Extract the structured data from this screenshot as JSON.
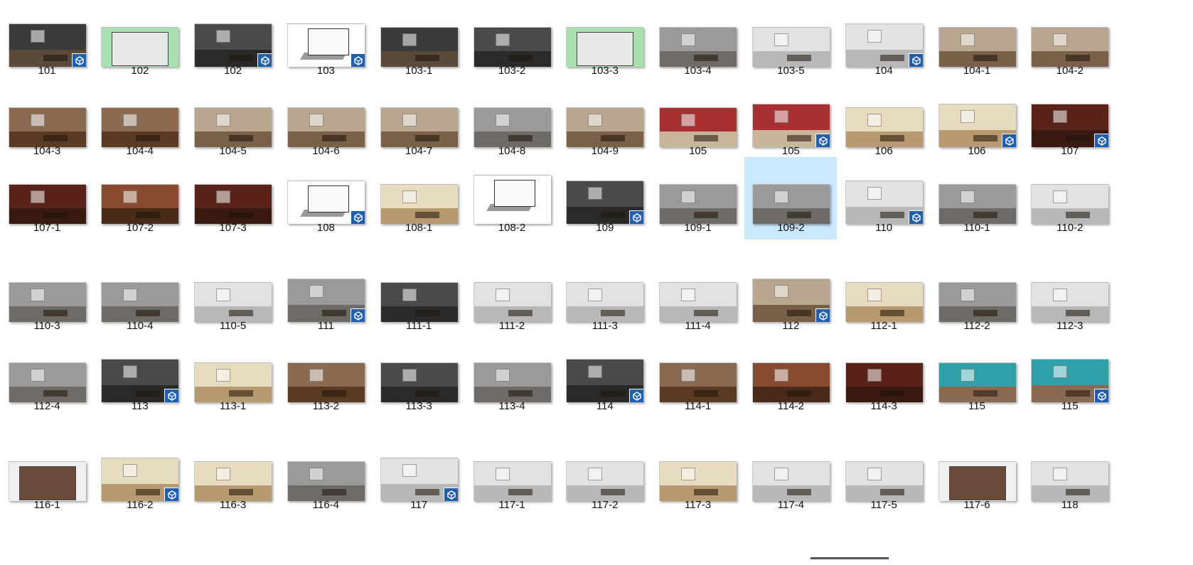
{
  "explorer": {
    "view": "large-icons",
    "selected_label": "109-2",
    "badge_icon": "sketchup-icon",
    "accent": "#cce8ff",
    "badge_color": "#1f5fae"
  },
  "rows": [
    [
      {
        "label": "101",
        "badge": true,
        "style": "dark"
      },
      {
        "label": "102",
        "badge": false,
        "style": "plan-green"
      },
      {
        "label": "102",
        "badge": true,
        "style": "gray-dark"
      },
      {
        "label": "103",
        "badge": true,
        "style": "sketch"
      },
      {
        "label": "103-1",
        "badge": false,
        "style": "dark"
      },
      {
        "label": "103-2",
        "badge": false,
        "style": "gray-dark"
      },
      {
        "label": "103-3",
        "badge": false,
        "style": "plan-green"
      },
      {
        "label": "103-4",
        "badge": false,
        "style": "gray"
      },
      {
        "label": "103-5",
        "badge": false,
        "style": "light"
      },
      {
        "label": "104",
        "badge": true,
        "style": "light"
      },
      {
        "label": "104-1",
        "badge": false,
        "style": "warm"
      },
      {
        "label": "104-2",
        "badge": false,
        "style": "warm"
      }
    ],
    [
      {
        "label": "104-3",
        "badge": false,
        "style": "wood"
      },
      {
        "label": "104-4",
        "badge": false,
        "style": "wood"
      },
      {
        "label": "104-5",
        "badge": false,
        "style": "warm"
      },
      {
        "label": "104-6",
        "badge": false,
        "style": "warm"
      },
      {
        "label": "104-7",
        "badge": false,
        "style": "warm"
      },
      {
        "label": "104-8",
        "badge": false,
        "style": "gray"
      },
      {
        "label": "104-9",
        "badge": false,
        "style": "warm"
      },
      {
        "label": "105",
        "badge": false,
        "style": "red"
      },
      {
        "label": "105",
        "badge": true,
        "style": "red"
      },
      {
        "label": "106",
        "badge": false,
        "style": "beige"
      },
      {
        "label": "106",
        "badge": true,
        "style": "beige"
      },
      {
        "label": "107",
        "badge": true,
        "style": "darkred"
      }
    ],
    [
      {
        "label": "107-1",
        "badge": false,
        "style": "darkred"
      },
      {
        "label": "107-2",
        "badge": false,
        "style": "brick"
      },
      {
        "label": "107-3",
        "badge": false,
        "style": "darkred"
      },
      {
        "label": "108",
        "badge": true,
        "style": "sketch"
      },
      {
        "label": "108-1",
        "badge": false,
        "style": "beige"
      },
      {
        "label": "108-2",
        "badge": false,
        "style": "sketch"
      },
      {
        "label": "109",
        "badge": true,
        "style": "gray-dark"
      },
      {
        "label": "109-1",
        "badge": false,
        "style": "gray"
      },
      {
        "label": "109-2",
        "badge": false,
        "style": "gray"
      },
      {
        "label": "110",
        "badge": true,
        "style": "light"
      },
      {
        "label": "110-1",
        "badge": false,
        "style": "gray"
      },
      {
        "label": "110-2",
        "badge": false,
        "style": "light"
      }
    ],
    [
      {
        "label": "110-3",
        "badge": false,
        "style": "gray"
      },
      {
        "label": "110-4",
        "badge": false,
        "style": "gray"
      },
      {
        "label": "110-5",
        "badge": false,
        "style": "light"
      },
      {
        "label": "111",
        "badge": true,
        "style": "gray"
      },
      {
        "label": "111-1",
        "badge": false,
        "style": "gray-dark"
      },
      {
        "label": "111-2",
        "badge": false,
        "style": "light"
      },
      {
        "label": "111-3",
        "badge": false,
        "style": "light"
      },
      {
        "label": "111-4",
        "badge": false,
        "style": "light"
      },
      {
        "label": "112",
        "badge": true,
        "style": "warm"
      },
      {
        "label": "112-1",
        "badge": false,
        "style": "beige"
      },
      {
        "label": "112-2",
        "badge": false,
        "style": "gray"
      },
      {
        "label": "112-3",
        "badge": false,
        "style": "light"
      }
    ],
    [
      {
        "label": "112-4",
        "badge": false,
        "style": "gray"
      },
      {
        "label": "113",
        "badge": true,
        "style": "gray-dark"
      },
      {
        "label": "113-1",
        "badge": false,
        "style": "beige"
      },
      {
        "label": "113-2",
        "badge": false,
        "style": "wood"
      },
      {
        "label": "113-3",
        "badge": false,
        "style": "gray-dark"
      },
      {
        "label": "113-4",
        "badge": false,
        "style": "gray"
      },
      {
        "label": "114",
        "badge": true,
        "style": "gray-dark"
      },
      {
        "label": "114-1",
        "badge": false,
        "style": "wood"
      },
      {
        "label": "114-2",
        "badge": false,
        "style": "brick"
      },
      {
        "label": "114-3",
        "badge": false,
        "style": "darkred"
      },
      {
        "label": "115",
        "badge": false,
        "style": "teal"
      },
      {
        "label": "115",
        "badge": true,
        "style": "teal"
      }
    ],
    [
      {
        "label": "116-1",
        "badge": false,
        "style": "plan-wood"
      },
      {
        "label": "116-2",
        "badge": true,
        "style": "beige"
      },
      {
        "label": "116-3",
        "badge": false,
        "style": "beige"
      },
      {
        "label": "116-4",
        "badge": false,
        "style": "gray"
      },
      {
        "label": "117",
        "badge": true,
        "style": "light"
      },
      {
        "label": "117-1",
        "badge": false,
        "style": "light"
      },
      {
        "label": "117-2",
        "badge": false,
        "style": "light"
      },
      {
        "label": "117-3",
        "badge": false,
        "style": "beige"
      },
      {
        "label": "117-4",
        "badge": false,
        "style": "light"
      },
      {
        "label": "117-5",
        "badge": false,
        "style": "light"
      },
      {
        "label": "117-6",
        "badge": false,
        "style": "plan-wood"
      },
      {
        "label": "118",
        "badge": false,
        "style": "light"
      }
    ]
  ],
  "palettes": {
    "dark": [
      "#3a3a3a",
      "#5a4a3a"
    ],
    "gray": [
      "#9a9a9a",
      "#6e6a66"
    ],
    "gray-dark": [
      "#4a4a4a",
      "#2a2a2a"
    ],
    "light": [
      "#e2e2e2",
      "#b8b8b8"
    ],
    "warm": [
      "#b8a78e",
      "#7a6048"
    ],
    "wood": [
      "#8a6a50",
      "#5a3a22"
    ],
    "red": [
      "#a83030",
      "#c9b59a"
    ],
    "darkred": [
      "#5a2218",
      "#3a1a10"
    ],
    "brick": [
      "#8a4a30",
      "#4a2a18"
    ],
    "beige": [
      "#e8dcc0",
      "#b89a70"
    ],
    "teal": [
      "#2ea0a8",
      "#8a6a50"
    ],
    "plan-green": [
      "#a8e0b0",
      "#e8e8e8"
    ],
    "plan-wood": [
      "#f0f0f0",
      "#6a4a3a"
    ]
  }
}
